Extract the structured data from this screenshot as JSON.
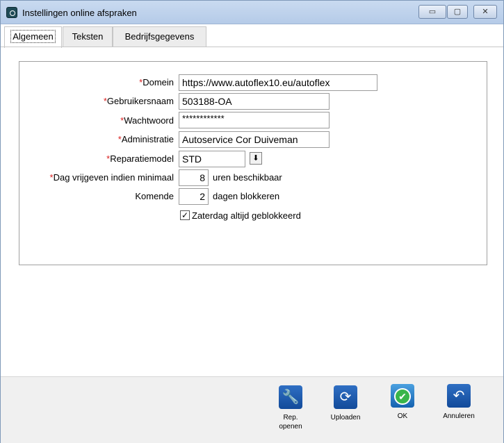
{
  "window": {
    "title": "Instellingen online afspraken",
    "controls": {
      "minimize": "▭",
      "maximize": "▢",
      "close": "✕"
    }
  },
  "tabs": [
    {
      "label": "Algemeen",
      "active": true
    },
    {
      "label": "Teksten",
      "active": false
    },
    {
      "label": "Bedrijfsgegevens",
      "active": false
    }
  ],
  "form": {
    "required_marker": "*",
    "domein": {
      "label": "Domein",
      "value": "https://www.autoflex10.eu/autoflex"
    },
    "gebruikersnaam": {
      "label": "Gebruikersnaam",
      "value": "503188-OA"
    },
    "wachtwoord": {
      "label": "Wachtwoord",
      "value": "************"
    },
    "administratie": {
      "label": "Administratie",
      "value": "Autoservice Cor Duiveman"
    },
    "reparatiemodel": {
      "label": "Reparatiemodel",
      "value": "STD",
      "dropdown_icon": "⬇"
    },
    "dag_vrijgeven": {
      "label": "Dag vrijgeven indien minimaal",
      "value": "8",
      "suffix": "uren beschikbaar"
    },
    "komende": {
      "label": "Komende",
      "value": "2",
      "suffix": "dagen blokkeren"
    },
    "zaterdag": {
      "label": "Zaterdag altijd geblokkeerd",
      "checked": true,
      "mark": "✓"
    }
  },
  "toolbar": {
    "rep_openen": {
      "label_line1": "Rep.",
      "label_line2": "openen",
      "icon": "wrench-icon",
      "glyph": "🔧"
    },
    "uploaden": {
      "label": "Uploaden",
      "icon": "sync-icon",
      "glyph": "⟳"
    },
    "ok": {
      "label": "OK",
      "icon": "check-icon",
      "glyph": "✔"
    },
    "annuleren": {
      "label": "Annuleren",
      "icon": "undo-icon",
      "glyph": "↶"
    }
  },
  "colors": {
    "required": "#d92020",
    "button_blue": "#1f5fb5",
    "ok_green": "#39b54a"
  }
}
